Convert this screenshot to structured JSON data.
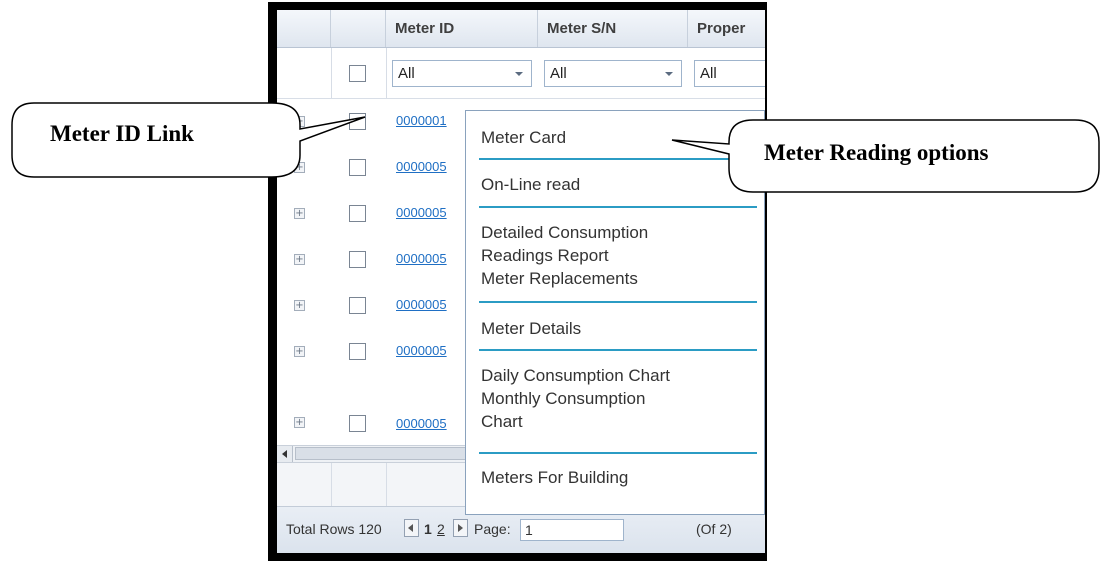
{
  "grid": {
    "columns": [
      "Meter ID",
      "Meter S/N",
      "Proper"
    ],
    "filters": [
      "All",
      "All",
      "All"
    ],
    "rows": [
      {
        "meter_id": "0000001"
      },
      {
        "meter_id": "0000005"
      },
      {
        "meter_id": "0000005"
      },
      {
        "meter_id": "0000005"
      },
      {
        "meter_id": "0000005"
      },
      {
        "meter_id": "0000005"
      },
      {
        "meter_id": "0000005"
      }
    ],
    "expander_symbol": "+"
  },
  "pager": {
    "total_label": "Total Rows 120",
    "page_one": "1",
    "page_two": "2",
    "page_label": "Page:",
    "page_value": "1",
    "of_label": "(Of 2)"
  },
  "context_menu": {
    "items": [
      "Meter Card",
      "On-Line read",
      "Detailed Consumption",
      "Readings Report",
      "Meter Replacements",
      "Meter Details",
      "Daily Consumption Chart",
      "Monthly Consumption",
      "Chart",
      "Meters For Building"
    ]
  },
  "callouts": {
    "left": "Meter ID Link",
    "right": "Meter Reading options"
  },
  "colors": {
    "link": "#1f6fc4",
    "menu_separator": "#2b9cc4",
    "frame": "#000000"
  }
}
